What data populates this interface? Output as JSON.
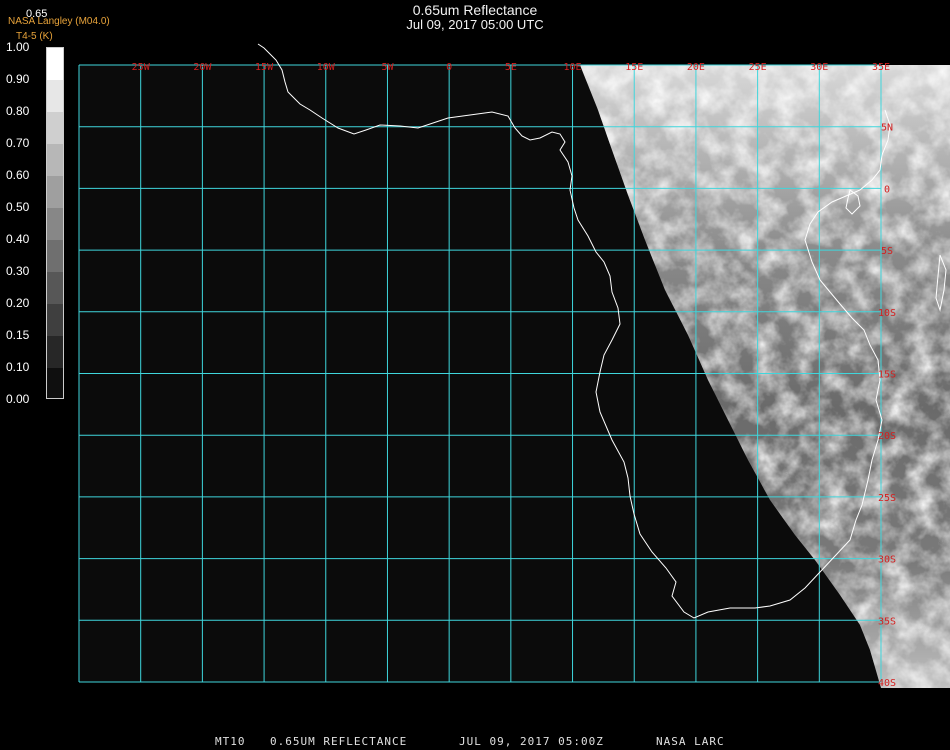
{
  "title": "0.65um Reflectance",
  "subtitle": "Jul 09, 2017 05:00 UTC",
  "source": "NASA Langley (M04.0)",
  "source2": "T4-5 (K)",
  "colorbar_title": "0.65",
  "colorbar": {
    "labels": [
      "1.00",
      "0.90",
      "0.80",
      "0.70",
      "0.60",
      "0.50",
      "0.40",
      "0.30",
      "0.20",
      "0.15",
      "0.10",
      "0.00"
    ],
    "min": 0.0,
    "max": 1.0
  },
  "longitude_labels": [
    "25W",
    "20W",
    "15W",
    "10W",
    "5W",
    "0",
    "5E",
    "10E",
    "15E",
    "20E",
    "25E",
    "30E",
    "35E"
  ],
  "latitude_labels": [
    "5N",
    "0",
    "5S",
    "10S",
    "15S",
    "20S",
    "25S",
    "30S",
    "35S",
    "40S"
  ],
  "footer": {
    "product": "MT10",
    "band": "0.65UM REFLECTANCE",
    "datetime": "JUL 09, 2017 05:00Z",
    "org": "NASA LARC"
  },
  "colors": {
    "grid": "#3fd6dc",
    "coast": "#ffffff",
    "tick_labels": "#d42020",
    "source": "#e8a33a"
  }
}
